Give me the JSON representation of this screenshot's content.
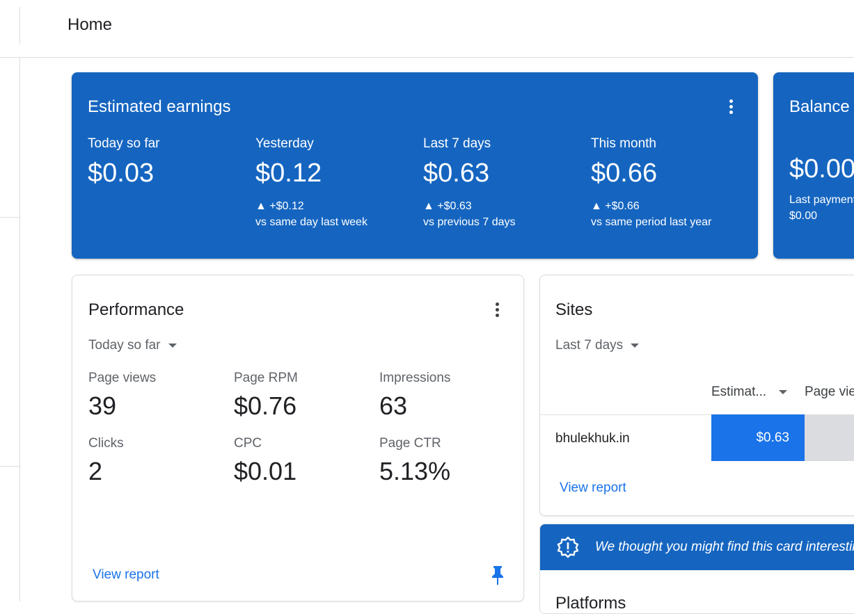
{
  "header": {
    "title": "Home"
  },
  "earnings": {
    "title": "Estimated earnings",
    "metrics": [
      {
        "label": "Today so far",
        "value": "$0.03",
        "delta": "",
        "compare": ""
      },
      {
        "label": "Yesterday",
        "value": "$0.12",
        "delta": "▲ +$0.12",
        "compare": "vs same day last week"
      },
      {
        "label": "Last 7 days",
        "value": "$0.63",
        "delta": "▲ +$0.63",
        "compare": "vs previous 7 days"
      },
      {
        "label": "This month",
        "value": "$0.66",
        "delta": "▲ +$0.66",
        "compare": "vs same period last year"
      }
    ]
  },
  "balance": {
    "title": "Balance",
    "value": "$0.00",
    "last_payment_label": "Last payment",
    "last_payment_value": "$0.00"
  },
  "performance": {
    "title": "Performance",
    "period": "Today so far",
    "stats": [
      {
        "label": "Page views",
        "value": "39"
      },
      {
        "label": "Page RPM",
        "value": "$0.76"
      },
      {
        "label": "Impressions",
        "value": "63"
      },
      {
        "label": "Clicks",
        "value": "2"
      },
      {
        "label": "CPC",
        "value": "$0.01"
      },
      {
        "label": "Page CTR",
        "value": "5.13%"
      }
    ],
    "view_report": "View report"
  },
  "sites": {
    "title": "Sites",
    "period": "Last 7 days",
    "columns": [
      "Estimat...",
      "Page views"
    ],
    "rows": [
      {
        "site": "bhulekhuk.in",
        "earnings": "$0.63"
      }
    ],
    "view_report": "View report"
  },
  "insight": {
    "banner": "We thought you might find this card interesting",
    "title": "Platforms"
  },
  "colors": {
    "brand_blue": "#1565c0",
    "link_blue": "#1a73e8"
  }
}
